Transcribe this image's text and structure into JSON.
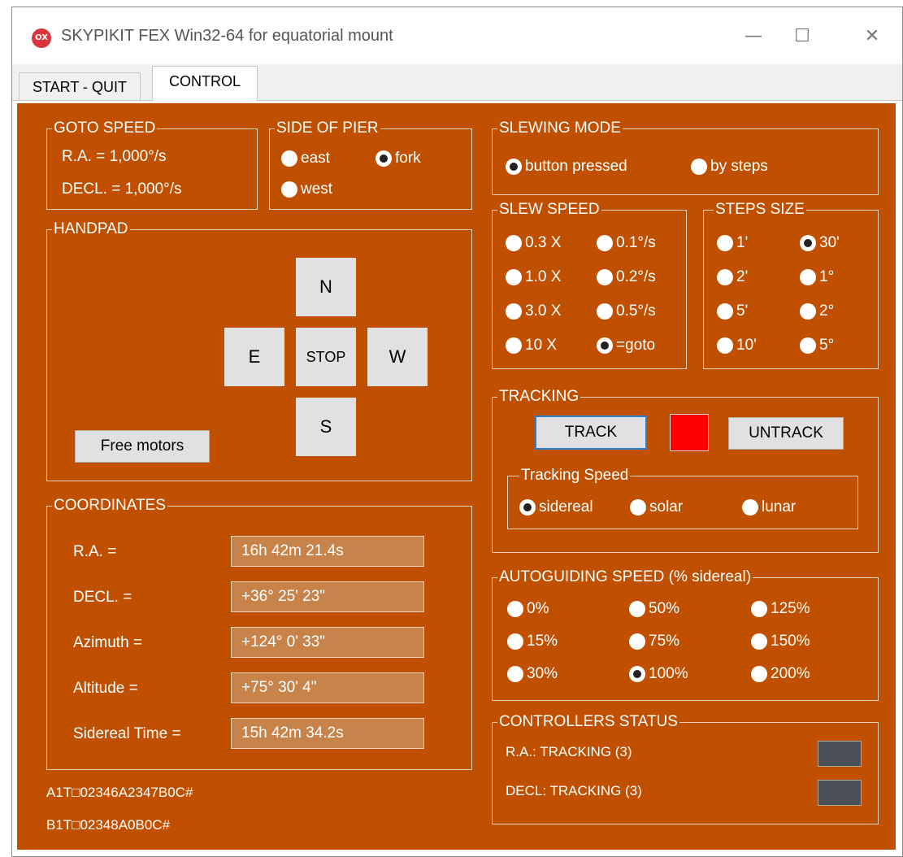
{
  "window": {
    "title": "SKYPIKIT FEX Win32-64  for equatorial mount",
    "icon_text": "OX",
    "minimize": "—",
    "maximize": "☐",
    "close": "✕"
  },
  "tabs": [
    {
      "label": "START - QUIT",
      "active": false
    },
    {
      "label": "CONTROL",
      "active": true
    }
  ],
  "colors": {
    "panel": "#c05000",
    "track_indicator": "#ff0000",
    "status_indicator": "#4a5055"
  },
  "goto_speed": {
    "title": "GOTO SPEED",
    "ra": "R.A. = 1,000°/s",
    "decl": "DECL. = 1,000°/s"
  },
  "side_of_pier": {
    "title": "SIDE OF PIER",
    "options": [
      {
        "label": "east",
        "selected": false
      },
      {
        "label": "fork",
        "selected": true
      },
      {
        "label": "west",
        "selected": false
      }
    ]
  },
  "handpad": {
    "title": "HANDPAD",
    "north": "N",
    "south": "S",
    "east": "E",
    "west": "W",
    "stop": "STOP",
    "free_motors": "Free motors"
  },
  "coordinates": {
    "title": "COORDINATES",
    "fields": [
      {
        "label": "R.A. =",
        "value": "16h 42m 21.4s"
      },
      {
        "label": "DECL. =",
        "value": "+36° 25' 23\""
      },
      {
        "label": "Azimuth =",
        "value": "+124° 0' 33\""
      },
      {
        "label": "Altitude =",
        "value": "+75° 30' 4\""
      },
      {
        "label": "Sidereal Time =",
        "value": "15h 42m 34.2s"
      }
    ]
  },
  "serial": {
    "line1": "A1T□02346A2347B0C#",
    "line2": "B1T□02348A0B0C#"
  },
  "slewing_mode": {
    "title": "SLEWING MODE",
    "options": [
      {
        "label": "button pressed",
        "selected": true
      },
      {
        "label": "by steps",
        "selected": false
      }
    ]
  },
  "slew_speed": {
    "title": "SLEW SPEED",
    "options": [
      {
        "label": "0.3 X",
        "selected": false
      },
      {
        "label": "0.1°/s",
        "selected": false
      },
      {
        "label": "1.0 X",
        "selected": false
      },
      {
        "label": "0.2°/s",
        "selected": false
      },
      {
        "label": "3.0 X",
        "selected": false
      },
      {
        "label": "0.5°/s",
        "selected": false
      },
      {
        "label": "10 X",
        "selected": false
      },
      {
        "label": "=goto",
        "selected": true
      }
    ]
  },
  "steps_size": {
    "title": "STEPS SIZE",
    "options": [
      {
        "label": "1'",
        "selected": false
      },
      {
        "label": "30'",
        "selected": true
      },
      {
        "label": "2'",
        "selected": false
      },
      {
        "label": "1°",
        "selected": false
      },
      {
        "label": "5'",
        "selected": false
      },
      {
        "label": "2°",
        "selected": false
      },
      {
        "label": "10'",
        "selected": false
      },
      {
        "label": "5°",
        "selected": false
      }
    ]
  },
  "tracking": {
    "title": "TRACKING",
    "track": "TRACK",
    "untrack": "UNTRACK",
    "speed_title": "Tracking Speed",
    "speed_options": [
      {
        "label": "sidereal",
        "selected": true
      },
      {
        "label": "solar",
        "selected": false
      },
      {
        "label": "lunar",
        "selected": false
      }
    ]
  },
  "autoguiding": {
    "title": "AUTOGUIDING SPEED  (% sidereal)",
    "options": [
      {
        "label": "0%",
        "selected": false
      },
      {
        "label": "50%",
        "selected": false
      },
      {
        "label": "125%",
        "selected": false
      },
      {
        "label": "15%",
        "selected": false
      },
      {
        "label": "75%",
        "selected": false
      },
      {
        "label": "150%",
        "selected": false
      },
      {
        "label": "30%",
        "selected": false
      },
      {
        "label": "100%",
        "selected": true
      },
      {
        "label": "200%",
        "selected": false
      }
    ]
  },
  "controllers_status": {
    "title": "CONTROLLERS STATUS",
    "ra": "R.A.: TRACKING (3)",
    "decl": "DECL: TRACKING (3)"
  }
}
